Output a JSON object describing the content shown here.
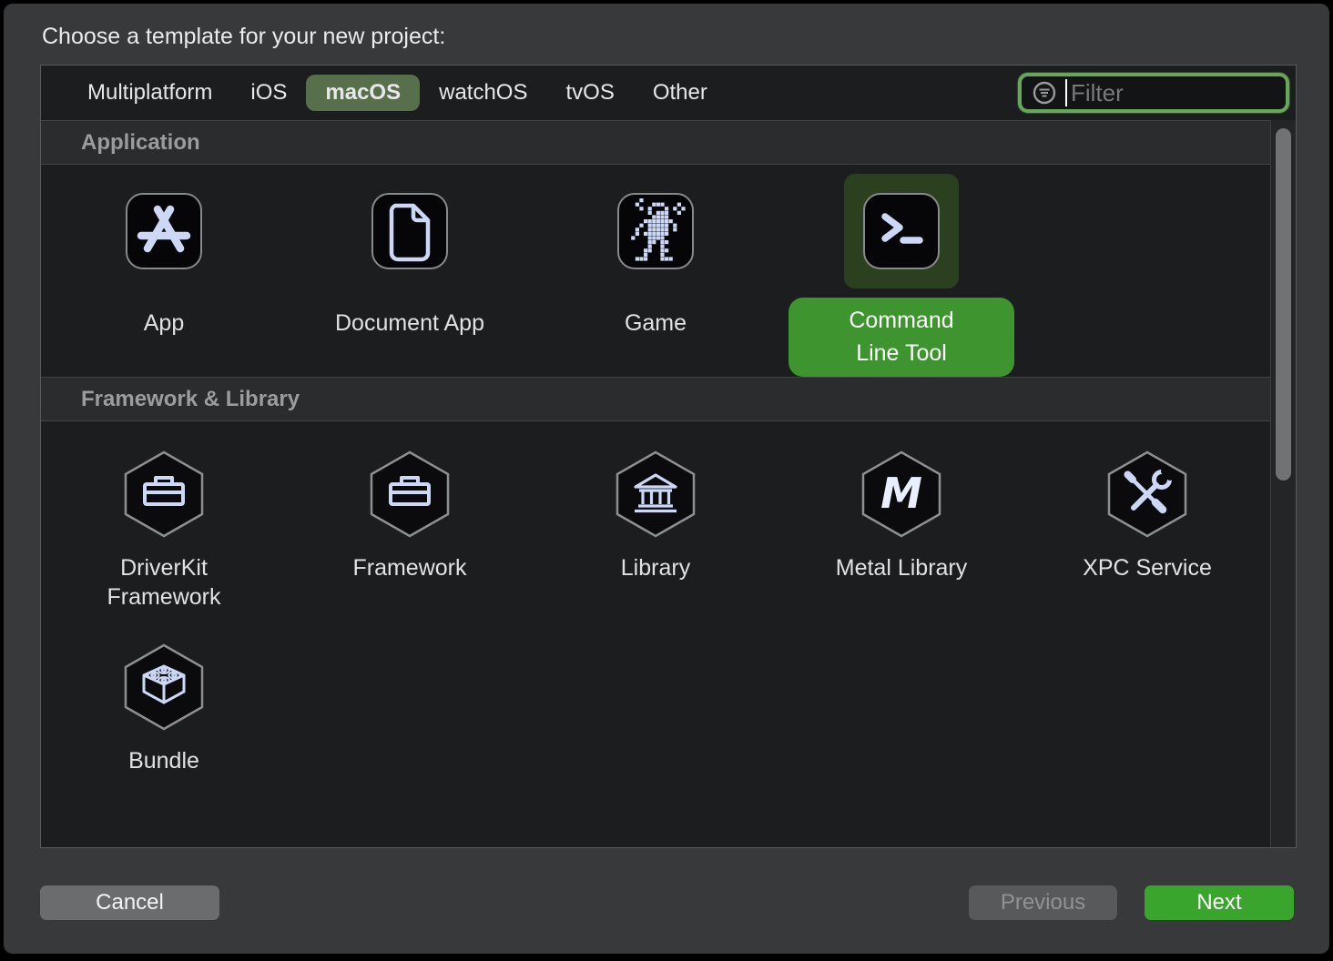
{
  "dialog": {
    "title": "Choose a template for your new project:"
  },
  "tabs": {
    "items": [
      {
        "label": "Multiplatform",
        "selected": false
      },
      {
        "label": "iOS",
        "selected": false
      },
      {
        "label": "macOS",
        "selected": true
      },
      {
        "label": "watchOS",
        "selected": false
      },
      {
        "label": "tvOS",
        "selected": false
      },
      {
        "label": "Other",
        "selected": false
      }
    ]
  },
  "filter": {
    "placeholder": "Filter",
    "icon": "filter-circle-icon"
  },
  "sections": [
    {
      "header": "Application",
      "templates": [
        {
          "label": "App",
          "icon": "app-store-icon",
          "selected": false
        },
        {
          "label": "Document App",
          "icon": "document-icon",
          "selected": false
        },
        {
          "label": "Game",
          "icon": "game-sprite-icon",
          "selected": false
        },
        {
          "label": "Command Line Tool",
          "icon": "terminal-icon",
          "selected": true
        }
      ]
    },
    {
      "header": "Framework & Library",
      "templates": [
        {
          "label": "DriverKit Framework",
          "icon": "toolbox-hexagon-icon",
          "selected": false
        },
        {
          "label": "Framework",
          "icon": "toolbox-hexagon-icon",
          "selected": false
        },
        {
          "label": "Library",
          "icon": "bank-hexagon-icon",
          "selected": false
        },
        {
          "label": "Metal Library",
          "icon": "metal-hexagon-icon",
          "selected": false
        },
        {
          "label": "XPC Service",
          "icon": "tools-hexagon-icon",
          "selected": false
        },
        {
          "label": "Bundle",
          "icon": "lego-hexagon-icon",
          "selected": false
        }
      ]
    }
  ],
  "footer": {
    "cancel_label": "Cancel",
    "previous_label": "Previous",
    "next_label": "Next",
    "previous_enabled": false
  },
  "colors": {
    "dialog_bg": "#38393a",
    "panel_bg": "#1c1d1e",
    "tab_selected_green": "#57704b",
    "selection_pill_green": "#3e9530",
    "selection_tile_green": "#2a401f",
    "next_button_green": "#3aa52c",
    "filter_focus_ring": "#68a75b",
    "icon_tint": "#ccd8f6"
  }
}
